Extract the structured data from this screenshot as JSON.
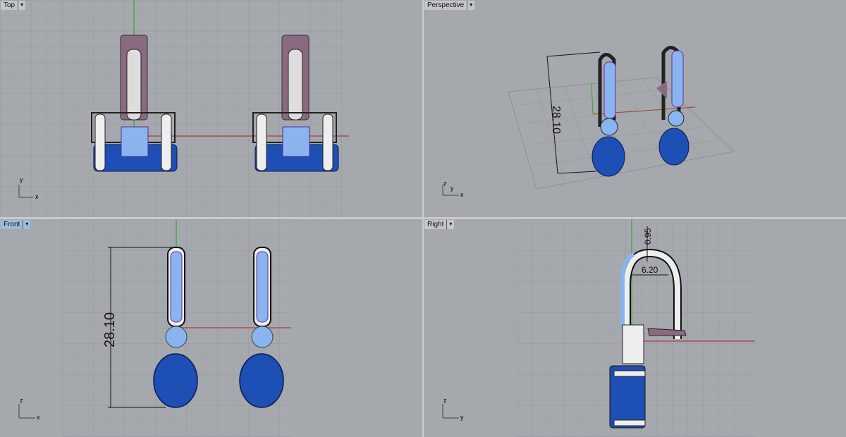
{
  "viewports": [
    {
      "name": "Top",
      "axes": [
        "y",
        "x"
      ]
    },
    {
      "name": "Perspective",
      "axes": [
        "z",
        "y",
        "x"
      ],
      "dimension": "28.10"
    },
    {
      "name": "Front",
      "axes": [
        "z",
        "x"
      ],
      "dimension": "28.10",
      "active": true
    },
    {
      "name": "Right",
      "axes": [
        "z",
        "y"
      ],
      "dimensions": [
        "0.95",
        "6.20"
      ]
    }
  ],
  "colors": {
    "background": "#a5a9ae",
    "grid": "#979ba1",
    "x_axis": "#b03a3a",
    "y_axis": "#3aa03a",
    "stone_large": "#1d4fb4",
    "stone_small": "#8ab4f0",
    "pave": "#8a3fa8",
    "metal": "#e8e8e8",
    "clip": "#8a6a80"
  }
}
